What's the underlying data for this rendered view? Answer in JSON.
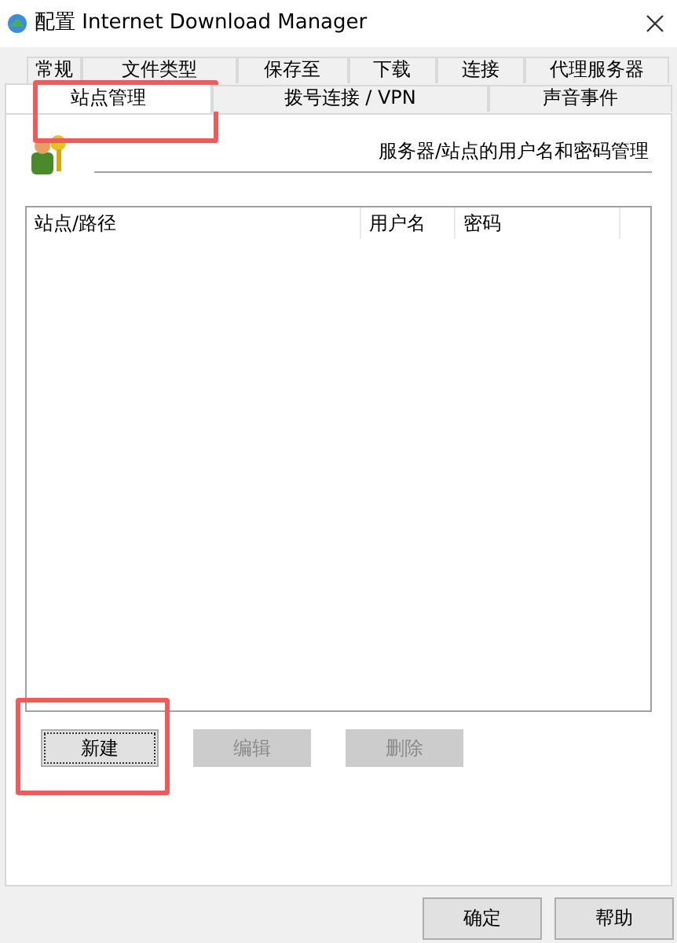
{
  "window": {
    "title": "配置 Internet Download Manager"
  },
  "tab_rows": [
    [
      {
        "label": "常规",
        "selected": false,
        "highlighted": false
      },
      {
        "label": "文件类型",
        "selected": false,
        "highlighted": false
      },
      {
        "label": "保存至",
        "selected": false,
        "highlighted": false
      },
      {
        "label": "下载",
        "selected": false,
        "highlighted": false
      },
      {
        "label": "连接",
        "selected": false,
        "highlighted": false
      },
      {
        "label": "代理服务器",
        "selected": false,
        "highlighted": false
      }
    ],
    [
      {
        "label": "站点管理",
        "selected": true,
        "highlighted": true
      },
      {
        "label": "拨号连接 / VPN",
        "selected": false,
        "highlighted": false
      },
      {
        "label": "声音事件",
        "selected": false,
        "highlighted": false
      }
    ]
  ],
  "heading": "服务器/站点的用户名和密码管理",
  "table": {
    "columns": [
      "站点/路径",
      "用户名",
      "密码"
    ]
  },
  "actions": [
    {
      "label": "新建",
      "disabled": false,
      "focused": true,
      "highlighted": true
    },
    {
      "label": "编辑",
      "disabled": true,
      "focused": false,
      "highlighted": false
    },
    {
      "label": "删除",
      "disabled": true,
      "focused": false,
      "highlighted": false
    }
  ],
  "buttons": [
    "确定",
    "帮助"
  ]
}
